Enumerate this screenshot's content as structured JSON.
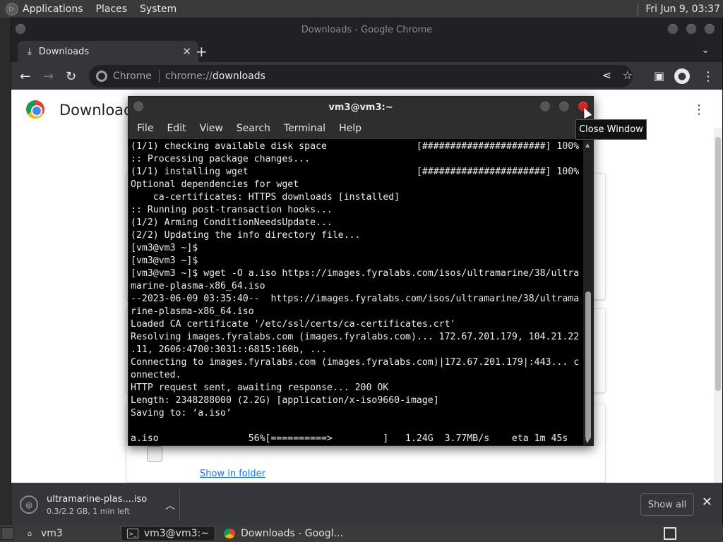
{
  "top_panel": {
    "menus": [
      "Applications",
      "Places",
      "System"
    ],
    "clock": "Fri Jun  9, 03:37"
  },
  "chrome": {
    "window_title": "Downloads - Google Chrome",
    "tab_title": "Downloads",
    "omnibox": {
      "chip": "Chrome",
      "url_scheme": "chrome://",
      "url_host": "downloads"
    },
    "page_title": "Downloads",
    "show_in_folder": "Show in folder",
    "shelf": {
      "file_name": "ultramarine-plas....iso",
      "status": "0.3/2.2 GB, 1 min left",
      "show_all": "Show all"
    }
  },
  "terminal": {
    "title": "vm3@vm3:~",
    "menus": [
      "File",
      "Edit",
      "View",
      "Search",
      "Terminal",
      "Help"
    ],
    "lines": [
      "(1/1) checking available disk space                [######################] 100%",
      ":: Processing package changes...",
      "(1/1) installing wget                              [######################] 100%",
      "Optional dependencies for wget",
      "    ca-certificates: HTTPS downloads [installed]",
      ":: Running post-transaction hooks...",
      "(1/2) Arming ConditionNeedsUpdate...",
      "(2/2) Updating the info directory file...",
      "[vm3@vm3 ~]$",
      "[vm3@vm3 ~]$",
      "[vm3@vm3 ~]$ wget -O a.iso https://images.fyralabs.com/isos/ultramarine/38/ultra",
      "marine-plasma-x86_64.iso",
      "--2023-06-09 03:35:40--  https://images.fyralabs.com/isos/ultramarine/38/ultrama",
      "rine-plasma-x86_64.iso",
      "Loaded CA certificate '/etc/ssl/certs/ca-certificates.crt'",
      "Resolving images.fyralabs.com (images.fyralabs.com)... 172.67.201.179, 104.21.22",
      ".11, 2606:4700:3031::6815:160b, ...",
      "Connecting to images.fyralabs.com (images.fyralabs.com)|172.67.201.179|:443... c",
      "onnected.",
      "HTTP request sent, awaiting response... 200 OK",
      "Length: 2348288000 (2.2G) [application/x-iso9660-image]",
      "Saving to: ‘a.iso’",
      "",
      "a.iso                56%[==========>         ]   1.24G  3.77MB/s    eta 1m 45s"
    ],
    "tooltip": "Close Window"
  },
  "taskbar": {
    "items": [
      "vm3",
      "vm3@vm3:~",
      "Downloads - Googl..."
    ]
  },
  "icons": {
    "tab_icon": "download-icon",
    "back": "back-arrow-icon",
    "forward": "forward-arrow-icon",
    "reload": "reload-icon",
    "share": "share-icon",
    "star": "star-icon",
    "sidebar": "side-panel-icon",
    "profile": "profile-icon",
    "menu": "more-vert-icon"
  }
}
